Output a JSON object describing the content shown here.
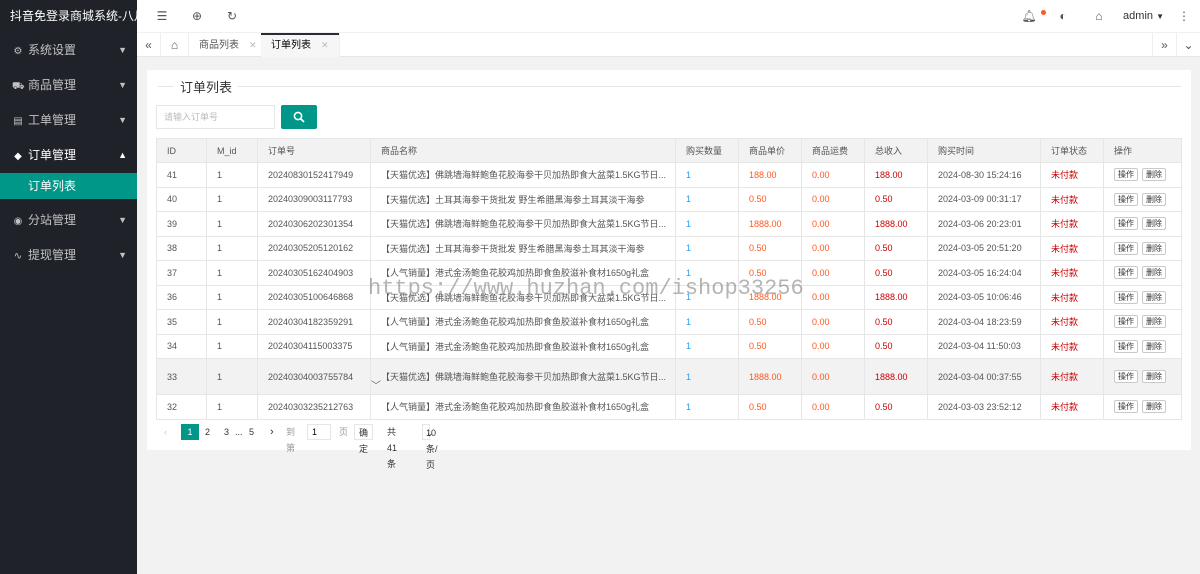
{
  "app": {
    "title": "抖音免登录商城系统-八月"
  },
  "sidebar": {
    "items": [
      {
        "label": "系统设置",
        "icon": "gear-icon"
      },
      {
        "label": "商品管理",
        "icon": "cart-icon"
      },
      {
        "label": "工单管理",
        "icon": "ticket-icon"
      },
      {
        "label": "订单管理",
        "icon": "layers-icon",
        "sub": [
          "订单列表"
        ]
      },
      {
        "label": "分站管理",
        "icon": "globe-icon"
      },
      {
        "label": "提现管理",
        "icon": "pulse-icon"
      }
    ]
  },
  "header": {
    "user": "admin"
  },
  "tabs": [
    {
      "label": "商品列表"
    },
    {
      "label": "订单列表"
    }
  ],
  "page": {
    "legend": "订单列表",
    "search_placeholder": "请输入订单号"
  },
  "table": {
    "headers": [
      "ID",
      "M_id",
      "订单号",
      "商品名称",
      "购买数量",
      "商品单价",
      "商品运费",
      "总收入",
      "购买时间",
      "订单状态",
      "操作"
    ],
    "rows": [
      [
        "41",
        "1",
        "20240830152417949",
        "【天猫优选】佛跳墙海鲜鲍鱼花胶海参干贝加热即食大盆菜1.5KG节日...",
        "1",
        "188.00",
        "0.00",
        "188.00",
        "2024-08-30 15:24:16",
        "未付款"
      ],
      [
        "40",
        "1",
        "20240309003117793",
        "【天猫优选】土耳其海参干货批发 野生希腊黑海参土耳其淡干海参",
        "1",
        "0.50",
        "0.00",
        "0.50",
        "2024-03-09 00:31:17",
        "未付款"
      ],
      [
        "39",
        "1",
        "20240306202301354",
        "【天猫优选】佛跳墙海鲜鲍鱼花胶海参干贝加热即食大盆菜1.5KG节日...",
        "1",
        "1888.00",
        "0.00",
        "1888.00",
        "2024-03-06 20:23:01",
        "未付款"
      ],
      [
        "38",
        "1",
        "20240305205120162",
        "【天猫优选】土耳其海参干货批发 野生希腊黑海参土耳其淡干海参",
        "1",
        "0.50",
        "0.00",
        "0.50",
        "2024-03-05 20:51:20",
        "未付款"
      ],
      [
        "37",
        "1",
        "20240305162404903",
        "【人气销量】港式金汤鲍鱼花胶鸡加热即食鱼胶滋补食材1650g礼盒",
        "1",
        "0.50",
        "0.00",
        "0.50",
        "2024-03-05 16:24:04",
        "未付款"
      ],
      [
        "36",
        "1",
        "20240305100646868",
        "【天猫优选】佛跳墙海鲜鲍鱼花胶海参干贝加热即食大盆菜1.5KG节日...",
        "1",
        "1888.00",
        "0.00",
        "1888.00",
        "2024-03-05 10:06:46",
        "未付款"
      ],
      [
        "35",
        "1",
        "20240304182359291",
        "【人气销量】港式金汤鲍鱼花胶鸡加热即食鱼胶滋补食材1650g礼盒",
        "1",
        "0.50",
        "0.00",
        "0.50",
        "2024-03-04 18:23:59",
        "未付款"
      ],
      [
        "34",
        "1",
        "20240304115003375",
        "【人气销量】港式金汤鲍鱼花胶鸡加热即食鱼胶滋补食材1650g礼盒",
        "1",
        "0.50",
        "0.00",
        "0.50",
        "2024-03-04 11:50:03",
        "未付款"
      ],
      [
        "33",
        "1",
        "20240304003755784",
        "【天猫优选】佛跳墙海鲜鲍鱼花胶海参干贝加热即食大盆菜1.5KG节日...",
        "1",
        "1888.00",
        "0.00",
        "1888.00",
        "2024-03-04 00:37:55",
        "未付款"
      ],
      [
        "32",
        "1",
        "20240303235212763",
        "【人气销量】港式金汤鲍鱼花胶鸡加热即食鱼胶滋补食材1650g礼盒",
        "1",
        "0.50",
        "0.00",
        "0.50",
        "2024-03-03 23:52:12",
        "未付款"
      ]
    ],
    "op_edit": "操作",
    "op_delete": "删除"
  },
  "pager": {
    "pages": [
      "1",
      "2",
      "3",
      "5"
    ],
    "ellipsis": "...",
    "goto_label": "到第",
    "page_value": "1",
    "page_unit": "页",
    "confirm": "确定",
    "total": "共 41 条",
    "size": "10 条/页"
  },
  "watermark": "https://www.huzhan.com/ishop33256"
}
